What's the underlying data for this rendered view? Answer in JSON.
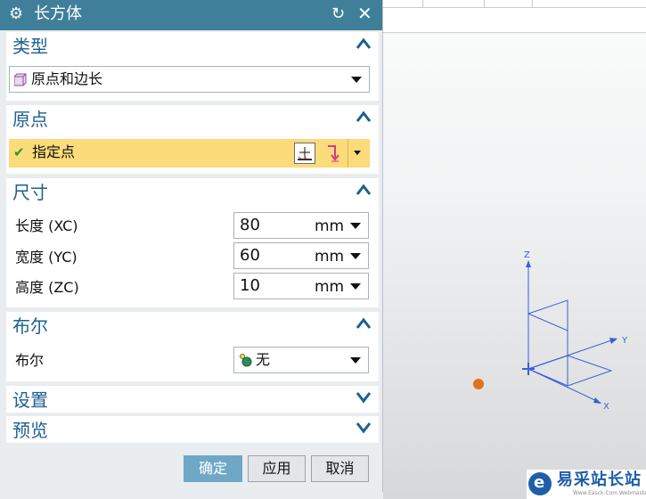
{
  "dialog": {
    "title": "长方体",
    "icons": {
      "settings": "gear-icon",
      "reset": "reset-icon",
      "close": "close-icon"
    }
  },
  "type_section": {
    "title": "类型",
    "selected": "原点和边长",
    "icon": "block-icon"
  },
  "origin_section": {
    "title": "原点",
    "point_label": "指定点",
    "icons": {
      "status": "checkmark-icon",
      "point_dialog": "point-dialog-icon",
      "inferred_point": "inferred-point-icon"
    }
  },
  "dimensions_section": {
    "title": "尺寸",
    "rows": [
      {
        "label": "长度 (XC)",
        "value": "80",
        "unit": "mm"
      },
      {
        "label": "宽度 (YC)",
        "value": "60",
        "unit": "mm"
      },
      {
        "label": "高度 (ZC)",
        "value": "10",
        "unit": "mm"
      }
    ]
  },
  "boolean_section": {
    "title": "布尔",
    "label": "布尔",
    "selected": "无",
    "icon": "boolean-none-icon"
  },
  "settings_section": {
    "title": "设置"
  },
  "preview_section": {
    "title": "预览"
  },
  "buttons": {
    "ok": "确定",
    "apply": "应用",
    "cancel": "取消"
  },
  "viewport": {
    "axis_labels": {
      "z": "Z",
      "y": "Y",
      "x": "X"
    },
    "axis_color": "#3a5fd9",
    "point_marker_color": "#e0731c"
  },
  "watermark": {
    "text": "易采站长站",
    "sub": "Www.Easck.Com Webmaster"
  },
  "colors": {
    "titlebar": "#3f7f9a",
    "section_title": "#1f5f8f",
    "highlight_row": "#fbdb7a",
    "primary_button": "#6fa8c6"
  }
}
